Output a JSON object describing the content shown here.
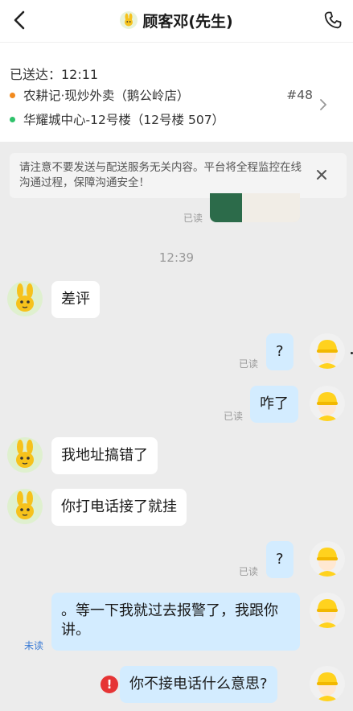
{
  "header": {
    "title": "顾客邓(先生)",
    "back_icon": "chevron-left-icon",
    "call_icon": "phone-icon"
  },
  "order": {
    "delivered_label": "已送达：12:11",
    "shop": "农耕记·现炒外卖（鹅公岭店）",
    "order_no": "#48",
    "address": "华耀城中心-12号楼（12号楼  507）",
    "shop_dot_color": "#f28a1e",
    "address_dot_color": "#2fc26b"
  },
  "notice": {
    "text": "请注意不要发送与配送服务无关内容。平台将全程监控在线沟通过程，保障沟通安全！",
    "close_icon": "close-icon"
  },
  "chat": {
    "image_read": "已读",
    "time": "12:39",
    "messages": [
      {
        "side": "left",
        "text": "差评",
        "status": ""
      },
      {
        "side": "right",
        "text": "?",
        "status": "已读"
      },
      {
        "side": "right",
        "text": "咋了",
        "status": "已读"
      },
      {
        "side": "left",
        "text": "我地址搞错了",
        "status": ""
      },
      {
        "side": "left",
        "text": "你打电话接了就挂",
        "status": ""
      },
      {
        "side": "right",
        "text": "?",
        "status": "已读"
      },
      {
        "side": "right",
        "text": "。等一下我就过去报警了，我跟你讲。",
        "status": "未读"
      },
      {
        "side": "right",
        "text": "你不接电话什么意思?",
        "status": "failed",
        "warn": "!"
      }
    ]
  }
}
